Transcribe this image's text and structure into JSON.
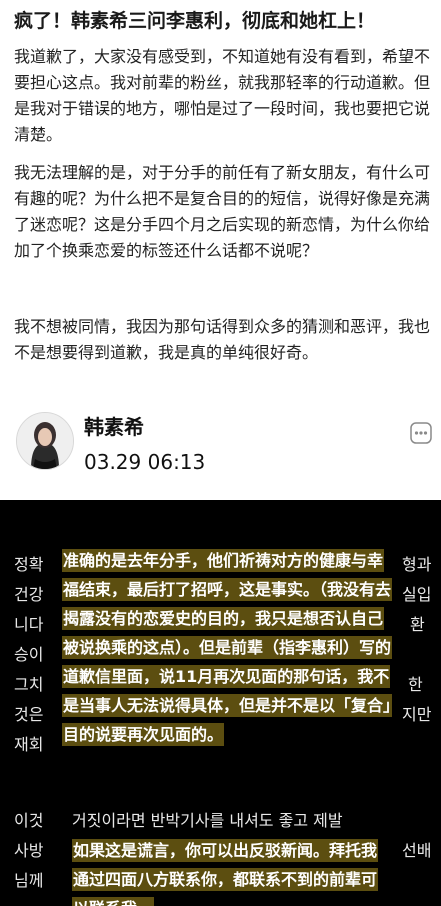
{
  "article": {
    "headline": "疯了！韩素希三问李惠利，彻底和她杠上！",
    "paragraphs": [
      "我道歉了，大家没有感受到，不知道她有没有看到，希望不要担心这点。我对前辈的粉丝，就我那轻率的行动道歉。但是我对于错误的地方，哪怕是过了一段时间，我也要把它说清楚。",
      "我无法理解的是，对于分手的前任有了新女朋友，有什么可有趣的呢？为什么把不是复合目的的短信，说得好像是充满了迷恋呢？这是分手四个月之后实现的新恋情，为什么你给加了个换乘恋爱的标签还什么话都不说呢？",
      "我不想被同情，我因为那句话得到众多的猜测和恶评，我也不是想要得到道歉，我是真的单纯很好奇。"
    ]
  },
  "author": {
    "name": "韩素希",
    "timestamp": "03.29 06:13"
  },
  "screenshot": {
    "korean_fragments": [
      "정확",
      "건강",
      "니다",
      "승이",
      "그치",
      "것은",
      "재회",
      "이것",
      "사방",
      "님께"
    ],
    "korean_right": [
      "형과",
      "실입",
      "환",
      "한",
      "지만"
    ],
    "korean_mid": "거짓이라면 반박기사를 내셔도 좋고 제발",
    "korean_right2": "선배",
    "translation_1": "准确的是去年分手，他们祈祷对方的健康与幸福结束，最后打了招呼，这是事实。（我没有去揭露没有的恋爱史的目的，我只是想否认自己被说换乘的这点）。但是前辈（指李惠利）写的道歉信里面，说11月再次见面的那句话，我不是当事人无法说得具体，但是并不是以「复合」目的说要再次见面的。",
    "translation_2": "如果这是谎言，你可以出反驳新闻。拜托我通过四面八方联系你，都联系不到的前辈可以联系我。"
  }
}
